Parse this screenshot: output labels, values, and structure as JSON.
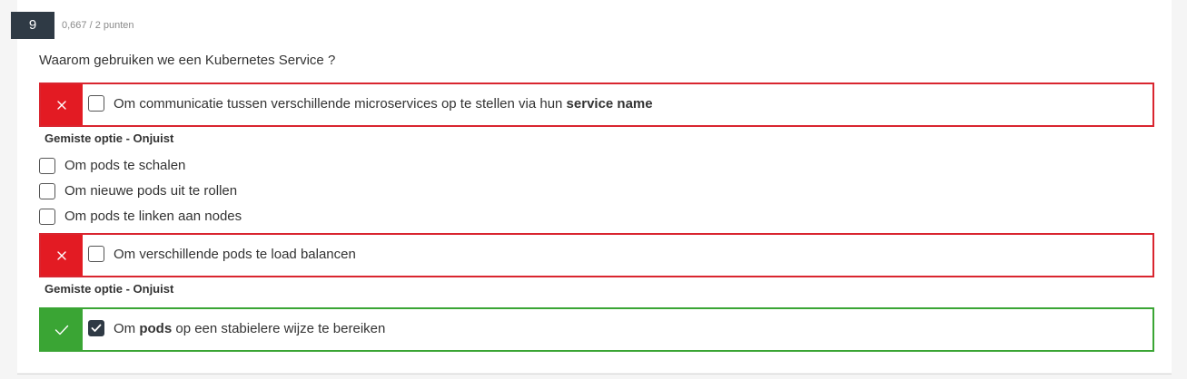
{
  "question": {
    "number": "9",
    "score": "0,667 / 2 punten",
    "text": "Waarom gebruiken we een Kubernetes Service ?"
  },
  "options": [
    {
      "label_parts": [
        "Om communicatie tussen verschillende microservices op te stellen via hun ",
        "service name"
      ],
      "checked": false,
      "status": "wrong",
      "feedback": "Gemiste optie - Onjuist",
      "status_icon": "cross-icon"
    },
    {
      "label": "Om pods te schalen",
      "checked": false
    },
    {
      "label": "Om nieuwe pods uit te rollen",
      "checked": false
    },
    {
      "label": "Om pods te linken aan nodes",
      "checked": false
    },
    {
      "label": "Om verschillende pods te load balancen",
      "checked": false,
      "status": "wrong",
      "feedback": "Gemiste optie - Onjuist",
      "status_icon": "cross-icon"
    },
    {
      "label_parts": [
        "Om ",
        "pods",
        " op een stabielere wijze te bereiken"
      ],
      "checked": true,
      "status": "correct",
      "status_icon": "check-icon"
    }
  ],
  "colors": {
    "wrong": "#e31b23",
    "correct": "#3aa534",
    "number_badge": "#2f3a45"
  }
}
